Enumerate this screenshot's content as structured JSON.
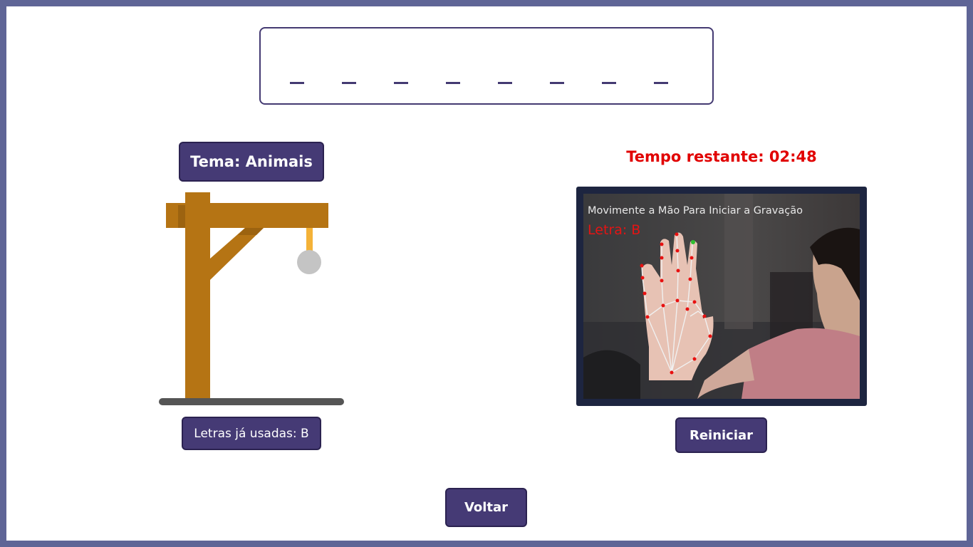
{
  "word": {
    "slots": [
      "_",
      "_",
      "_",
      "_",
      "_",
      "_",
      "_",
      "_"
    ]
  },
  "theme": {
    "label": "Tema: Animais"
  },
  "used_letters": {
    "label": "Letras já usadas: B"
  },
  "timer": {
    "label": "Tempo restante: 02:48"
  },
  "camera": {
    "instruction": "Movimente a Mão Para Iniciar a Gravação",
    "letter": "Letra: B"
  },
  "buttons": {
    "restart": "Reiniciar",
    "back": "Voltar"
  },
  "colors": {
    "border": "#5f6596",
    "accent": "#453a75",
    "timer": "#e10000",
    "wood": "#b57414",
    "rope": "#f4b238",
    "head": "#c4c4c4",
    "base": "#555555"
  }
}
